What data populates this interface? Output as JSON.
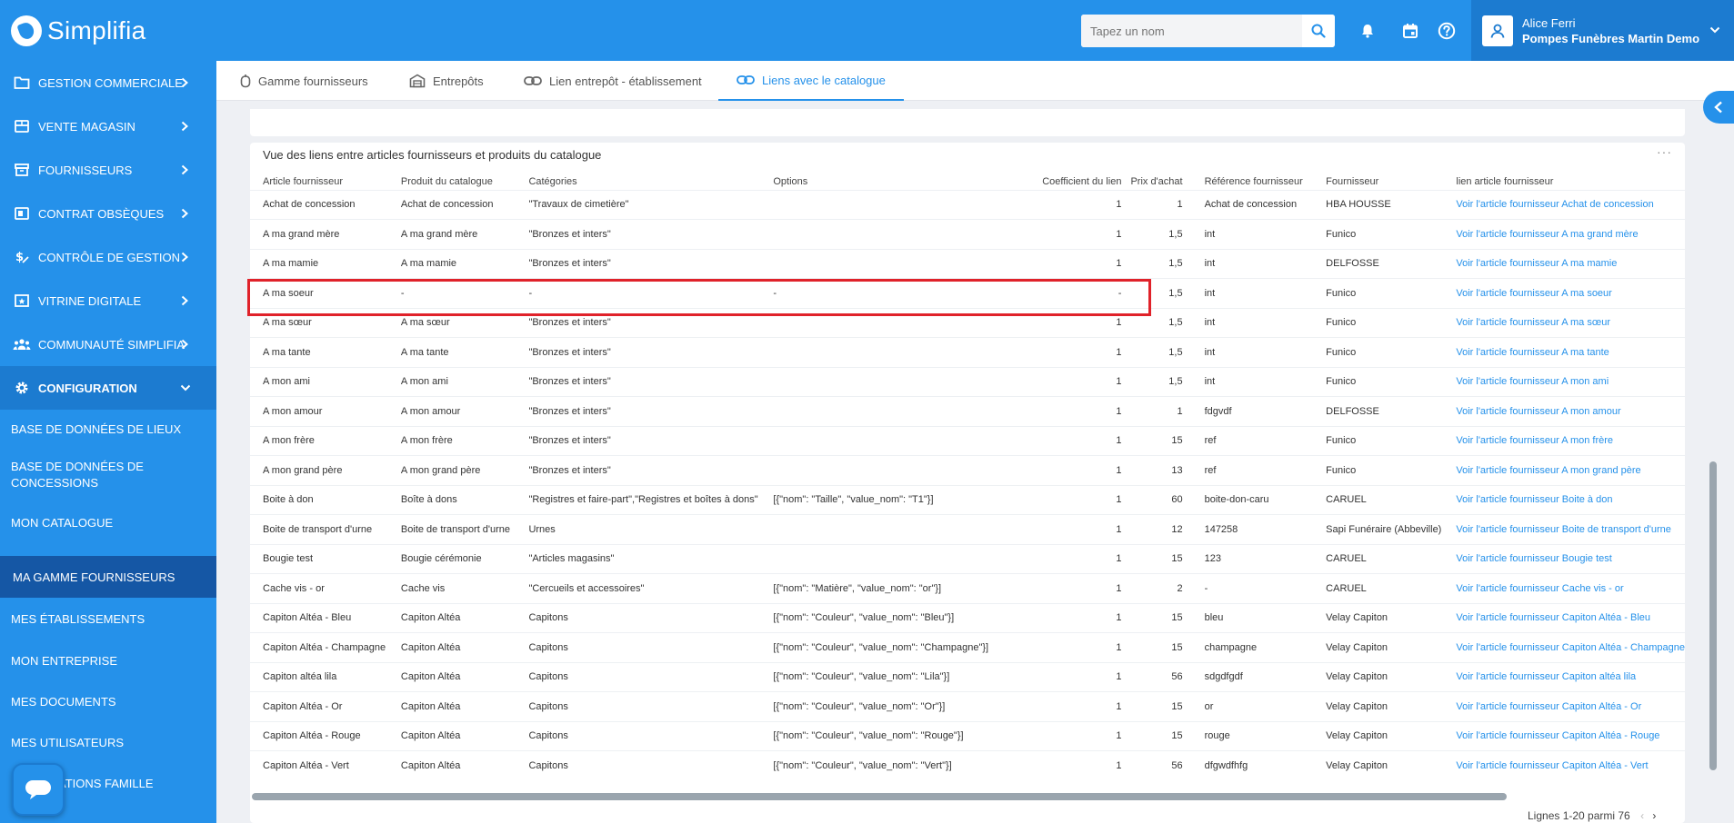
{
  "app": {
    "name": "Simplifia"
  },
  "search": {
    "placeholder": "Tapez un nom"
  },
  "user": {
    "name": "Alice Ferri",
    "company": "Pompes Funèbres Martin Demo"
  },
  "sidebar": {
    "items": [
      {
        "label": "Gestion commerciale",
        "icon": "folder-icon"
      },
      {
        "label": "Vente magasin",
        "icon": "store-icon"
      },
      {
        "label": "Fournisseurs",
        "icon": "box-icon"
      },
      {
        "label": "Contrat obsèques",
        "icon": "contract-icon"
      },
      {
        "label": "Contrôle de gestion",
        "icon": "money-icon"
      },
      {
        "label": "Vitrine digitale",
        "icon": "showcase-icon"
      },
      {
        "label": "Communauté Simplifia",
        "icon": "community-icon"
      },
      {
        "label": "Configuration",
        "icon": "gear-icon"
      }
    ],
    "sub_items": [
      {
        "label": "Base de données de lieux"
      },
      {
        "label": "Base de données de concessions"
      },
      {
        "label": "Mon catalogue"
      },
      {
        "label": "Ma gamme fournisseurs"
      },
      {
        "label": "Mes établissements"
      },
      {
        "label": "Mon entreprise"
      },
      {
        "label": "Mes documents"
      },
      {
        "label": "Mes utilisateurs"
      },
      {
        "label": "Notifications famille"
      }
    ]
  },
  "tabs": [
    {
      "label": "Gamme fournisseurs",
      "icon": "tag-icon"
    },
    {
      "label": "Entrepôts",
      "icon": "warehouse-icon"
    },
    {
      "label": "Lien entrepôt - établissement",
      "icon": "link-icon"
    },
    {
      "label": "Liens avec le catalogue",
      "icon": "link-icon"
    }
  ],
  "card": {
    "title": "Vue des liens entre articles fournisseurs et produits du catalogue",
    "menu": "···"
  },
  "table": {
    "headers": [
      "Article fournisseur",
      "Produit du catalogue",
      "Catégories",
      "Options",
      "Coefficient du lien",
      "Prix d'achat",
      "Référence fournisseur",
      "Fournisseur",
      "lien article fournisseur"
    ],
    "rows": [
      [
        "Achat de concession",
        "Achat de concession",
        "\"Travaux de cimetière\"",
        "",
        "1",
        "1",
        "Achat de concession",
        "HBA HOUSSE",
        "Voir l'article fournisseur Achat de concession"
      ],
      [
        "A ma grand mère",
        "A ma grand mère",
        "\"Bronzes et inters\"",
        "",
        "1",
        "1,5",
        "int",
        "Funico",
        "Voir l'article fournisseur A ma grand mère"
      ],
      [
        "A ma mamie",
        "A ma mamie",
        "\"Bronzes et inters\"",
        "",
        "1",
        "1,5",
        "int",
        "DELFOSSE",
        "Voir l'article fournisseur A ma mamie"
      ],
      [
        "A ma soeur",
        "-",
        "-",
        "-",
        "-",
        "1,5",
        "int",
        "Funico",
        "Voir l'article fournisseur A ma soeur"
      ],
      [
        "A ma sœur",
        "A ma sœur",
        "\"Bronzes et inters\"",
        "",
        "1",
        "1,5",
        "int",
        "Funico",
        "Voir l'article fournisseur A ma sœur"
      ],
      [
        "A ma tante",
        "A ma tante",
        "\"Bronzes et inters\"",
        "",
        "1",
        "1,5",
        "int",
        "Funico",
        "Voir l'article fournisseur A ma tante"
      ],
      [
        "A mon ami",
        "A mon ami",
        "\"Bronzes et inters\"",
        "",
        "1",
        "1,5",
        "int",
        "Funico",
        "Voir l'article fournisseur A mon ami"
      ],
      [
        "A mon amour",
        "A mon amour",
        "\"Bronzes et inters\"",
        "",
        "1",
        "1",
        "fdgvdf",
        "DELFOSSE",
        "Voir l'article fournisseur A mon amour"
      ],
      [
        "A mon frère",
        "A mon frère",
        "\"Bronzes et inters\"",
        "",
        "1",
        "15",
        "ref",
        "Funico",
        "Voir l'article fournisseur A mon frère"
      ],
      [
        "A mon grand père",
        "A mon grand père",
        "\"Bronzes et inters\"",
        "",
        "1",
        "13",
        "ref",
        "Funico",
        "Voir l'article fournisseur A mon grand père"
      ],
      [
        "Boite à don",
        "Boîte à dons",
        "\"Registres et faire-part\",\"Registres et boîtes à dons\"",
        "[{\"nom\": \"Taille\", \"value_nom\": \"T1\"}]",
        "1",
        "60",
        "boite-don-caru",
        "CARUEL",
        "Voir l'article fournisseur Boite à don"
      ],
      [
        "Boite de transport d'urne",
        "Boite de transport d'urne",
        "Urnes",
        "",
        "1",
        "12",
        "147258",
        "Sapi Funéraire (Abbeville)",
        "Voir l'article fournisseur Boite de transport d'urne"
      ],
      [
        "Bougie test",
        "Bougie cérémonie",
        "\"Articles magasins\"",
        "",
        "1",
        "15",
        "123",
        "CARUEL",
        "Voir l'article fournisseur Bougie test"
      ],
      [
        "Cache vis - or",
        "Cache vis",
        "\"Cercueils et accessoires\"",
        "[{\"nom\": \"Matière\", \"value_nom\": \"or\"}]",
        "1",
        "2",
        "-",
        "CARUEL",
        "Voir l'article fournisseur Cache vis - or"
      ],
      [
        "Capiton Altéa - Bleu",
        "Capiton Altéa",
        "Capitons",
        "[{\"nom\": \"Couleur\", \"value_nom\": \"Bleu\"}]",
        "1",
        "15",
        "bleu",
        "Velay Capiton",
        "Voir l'article fournisseur Capiton Altéa - Bleu"
      ],
      [
        "Capiton Altéa - Champagne",
        "Capiton Altéa",
        "Capitons",
        "[{\"nom\": \"Couleur\", \"value_nom\": \"Champagne\"}]",
        "1",
        "15",
        "champagne",
        "Velay Capiton",
        "Voir l'article fournisseur Capiton Altéa - Champagne"
      ],
      [
        "Capiton altéa lila",
        "Capiton Altéa",
        "Capitons",
        "[{\"nom\": \"Couleur\", \"value_nom\": \"Lila\"}]",
        "1",
        "56",
        "sdgdfgdf",
        "Velay Capiton",
        "Voir l'article fournisseur Capiton altéa lila"
      ],
      [
        "Capiton Altéa - Or",
        "Capiton Altéa",
        "Capitons",
        "[{\"nom\": \"Couleur\", \"value_nom\": \"Or\"}]",
        "1",
        "15",
        "or",
        "Velay Capiton",
        "Voir l'article fournisseur Capiton Altéa - Or"
      ],
      [
        "Capiton Altéa - Rouge",
        "Capiton Altéa",
        "Capitons",
        "[{\"nom\": \"Couleur\", \"value_nom\": \"Rouge\"}]",
        "1",
        "15",
        "rouge",
        "Velay Capiton",
        "Voir l'article fournisseur Capiton Altéa - Rouge"
      ],
      [
        "Capiton Altéa - Vert",
        "Capiton Altéa",
        "Capitons",
        "[{\"nom\": \"Couleur\", \"value_nom\": \"Vert\"}]",
        "1",
        "56",
        "dfgwdfhfg",
        "Velay Capiton",
        "Voir l'article fournisseur Capiton Altéa - Vert"
      ]
    ]
  },
  "pager": {
    "text": "Lignes 1-20 parmi 76"
  },
  "colors": {
    "primary": "#2591ea",
    "primary_dark": "#1c7bd0",
    "active_sub": "#1557a5",
    "highlight": "#e0222a"
  }
}
